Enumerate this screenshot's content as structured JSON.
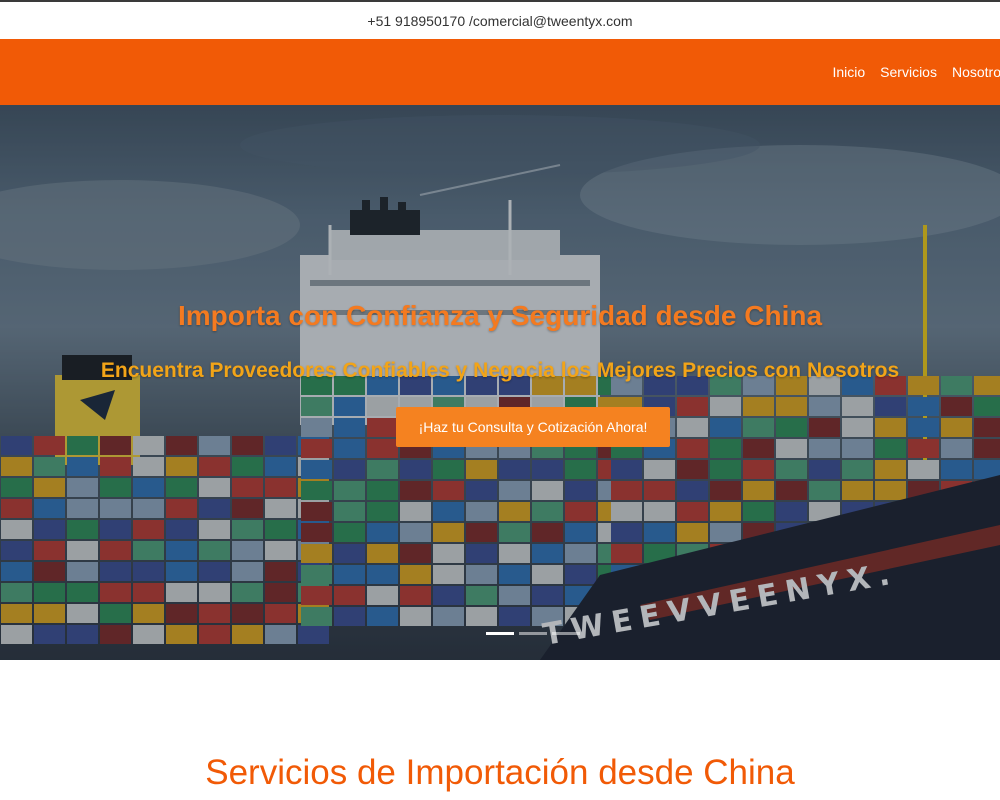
{
  "topbar": {
    "contact": "+51 918950170 /comercial@tweentyx.com"
  },
  "nav": {
    "items": [
      {
        "label": "Inicio"
      },
      {
        "label": "Servicios"
      },
      {
        "label": "Nosotros"
      }
    ]
  },
  "hero": {
    "title": "Importa con Confianza y Seguridad desde China",
    "subtitle": "Encuentra Proveedores Confiables y Negocia los Mejores Precios con Nosotros",
    "cta_label": "¡Haz tu Consulta y Cotización Ahora!",
    "ship_name": "TWEEVVEENYX.",
    "slides_count": 3,
    "active_slide": 1
  },
  "services": {
    "title": "Servicios de Importación desde China"
  },
  "colors": {
    "brand_orange": "#f15a06",
    "title_orange": "#f47a20",
    "subtitle_amber": "#f2a418",
    "cta_orange": "#f58220"
  }
}
